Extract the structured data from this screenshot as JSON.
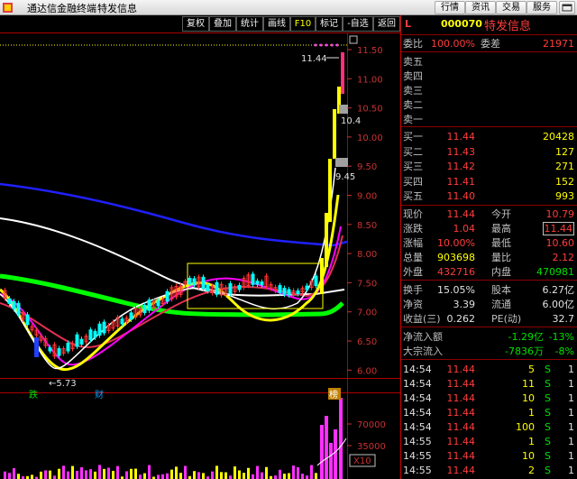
{
  "app": {
    "title": "通达信金融终端",
    "module": "特发信息"
  },
  "menu": [
    "行情",
    "资讯",
    "交易",
    "服务"
  ],
  "toolbar": [
    "复权",
    "叠加",
    "统计",
    "画线",
    "F10",
    "标记",
    "-自选",
    "返回"
  ],
  "chart": {
    "price_axis": [
      "11.50",
      "11.00",
      "10.50",
      "10.00",
      "9.50",
      "9.00",
      "8.50",
      "8.00",
      "7.50",
      "7.00",
      "6.50",
      "6.00"
    ],
    "volume_axis": [
      "70000",
      "35000",
      "X10"
    ],
    "annotations": {
      "high": "11.44",
      "low": "5.73",
      "mid1": "10.4",
      "mid2": "9.45"
    },
    "markers": [
      "跌",
      "财",
      "榜"
    ],
    "colors": {
      "up": "#ff3232",
      "down": "#00ffff",
      "ma5": "#ffffff",
      "ma10": "#ffff00",
      "ma20": "#ff00ff",
      "ma60": "#00ff00",
      "ma120": "#2020ff",
      "ma250": "#ffffff"
    }
  },
  "panel": {
    "flag": "L",
    "code": "000070",
    "name": "特发信息",
    "weibi_label": "委比",
    "weibi": "100.00%",
    "weicha_label": "委差",
    "weicha": "21971",
    "sell": [
      {
        "label": "卖五",
        "price": "",
        "vol": ""
      },
      {
        "label": "卖四",
        "price": "",
        "vol": ""
      },
      {
        "label": "卖三",
        "price": "",
        "vol": ""
      },
      {
        "label": "卖二",
        "price": "",
        "vol": ""
      },
      {
        "label": "卖一",
        "price": "",
        "vol": ""
      }
    ],
    "buy": [
      {
        "label": "买一",
        "price": "11.44",
        "vol": "20428"
      },
      {
        "label": "买二",
        "price": "11.43",
        "vol": "127"
      },
      {
        "label": "买三",
        "price": "11.42",
        "vol": "271"
      },
      {
        "label": "买四",
        "price": "11.41",
        "vol": "152"
      },
      {
        "label": "买五",
        "price": "11.40",
        "vol": "993"
      }
    ],
    "stats": [
      {
        "l1": "现价",
        "v1": "11.44",
        "l2": "今开",
        "v2": "10.79"
      },
      {
        "l1": "涨跌",
        "v1": "1.04",
        "l2": "最高",
        "v2": "11.44"
      },
      {
        "l1": "涨幅",
        "v1": "10.00%",
        "l2": "最低",
        "v2": "10.60"
      },
      {
        "l1": "总量",
        "v1": "903698",
        "l2": "量比",
        "v2": "2.12"
      },
      {
        "l1": "外盘",
        "v1": "432716",
        "l2": "内盘",
        "v2": "470981"
      }
    ],
    "stats2": [
      {
        "l1": "换手",
        "v1": "15.05%",
        "l2": "股本",
        "v2": "6.27亿"
      },
      {
        "l1": "净资",
        "v1": "3.39",
        "l2": "流通",
        "v2": "6.00亿"
      },
      {
        "l1": "收益(三)",
        "v1": "0.262",
        "l2": "PE(动)",
        "v2": "32.7"
      }
    ],
    "flow": [
      {
        "label": "净流入额",
        "value": "-1.29亿",
        "pct": "-13%"
      },
      {
        "label": "大宗流入",
        "value": "-7836万",
        "pct": "-8%"
      }
    ],
    "ticks": [
      {
        "time": "14:54",
        "price": "11.44",
        "vol": "5",
        "side": "S",
        "n": "1"
      },
      {
        "time": "14:54",
        "price": "11.44",
        "vol": "11",
        "side": "S",
        "n": "1"
      },
      {
        "time": "14:54",
        "price": "11.44",
        "vol": "10",
        "side": "S",
        "n": "1"
      },
      {
        "time": "14:54",
        "price": "11.44",
        "vol": "1",
        "side": "S",
        "n": "1"
      },
      {
        "time": "14:54",
        "price": "11.44",
        "vol": "100",
        "side": "S",
        "n": "1"
      },
      {
        "time": "14:55",
        "price": "11.44",
        "vol": "1",
        "side": "S",
        "n": "1"
      },
      {
        "time": "14:55",
        "price": "11.44",
        "vol": "10",
        "side": "S",
        "n": "1"
      },
      {
        "time": "14:55",
        "price": "11.44",
        "vol": "2",
        "side": "S",
        "n": "1"
      }
    ]
  }
}
